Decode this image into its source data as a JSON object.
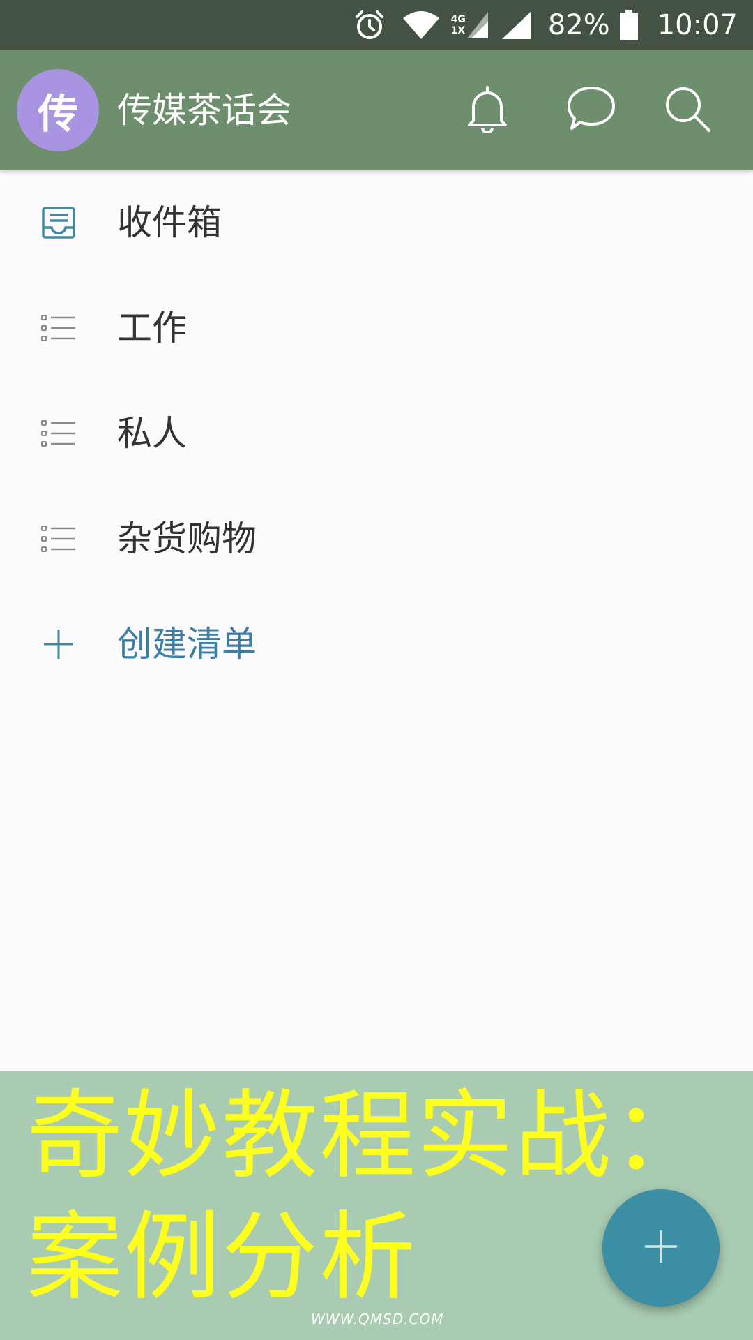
{
  "status_bar": {
    "network_top": "4G",
    "network_bottom": "1X",
    "battery": "82%",
    "time": "10:07"
  },
  "app_bar": {
    "avatar_letter": "传",
    "title": "传媒茶话会",
    "icons": [
      "bell-icon",
      "chat-icon",
      "search-icon"
    ]
  },
  "lists": {
    "items": [
      {
        "label": "收件箱",
        "icon": "inbox-icon"
      },
      {
        "label": "工作",
        "icon": "list-icon"
      },
      {
        "label": "私人",
        "icon": "list-icon"
      },
      {
        "label": "杂货购物",
        "icon": "list-icon"
      }
    ],
    "create_label": "创建清单"
  },
  "banner": {
    "line1": "奇妙教程实战：",
    "line2": "案例分析",
    "watermark": "WWW.QMSD.COM"
  },
  "colors": {
    "status_bar": "#445244",
    "app_bar": "#6d8f6d",
    "avatar": "#a894e0",
    "accent": "#3a7ea6",
    "fab": "#3b8ea3",
    "banner_bg": "#a8cbb2",
    "banner_text": "#ffff1e"
  }
}
